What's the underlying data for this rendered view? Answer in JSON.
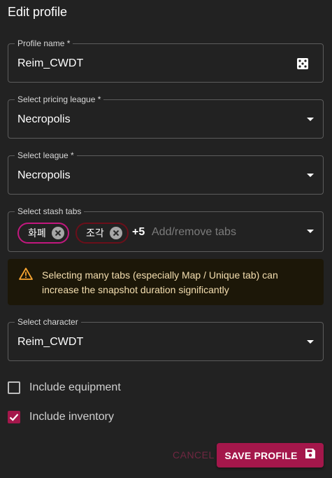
{
  "dialog": {
    "title": "Edit profile"
  },
  "profile_name": {
    "label": "Profile name *",
    "value": "Reim_CWDT",
    "icon": "dice-icon"
  },
  "pricing_league": {
    "label": "Select pricing league *",
    "value": "Necropolis"
  },
  "league": {
    "label": "Select league *",
    "value": "Necropolis"
  },
  "stash_tabs": {
    "label": "Select stash tabs",
    "chips": [
      {
        "label": "화폐",
        "color": "#c2187f"
      },
      {
        "label": "조각",
        "color": "#6b0f1a"
      }
    ],
    "more": "+5",
    "placeholder": "Add/remove tabs"
  },
  "warning": {
    "text": "Selecting many tabs (especially Map / Unique tab) can increase the snapshot duration significantly",
    "icon": "warning-icon",
    "color": "#f7a531"
  },
  "character": {
    "label": "Select character",
    "value": "Reim_CWDT"
  },
  "include_equipment": {
    "label": "Include equipment",
    "checked": false
  },
  "include_inventory": {
    "label": "Include inventory",
    "checked": true
  },
  "actions": {
    "cancel": "CANCEL",
    "save": "SAVE PROFILE"
  },
  "theme": {
    "accent": "#a4174b",
    "background": "#222222"
  }
}
